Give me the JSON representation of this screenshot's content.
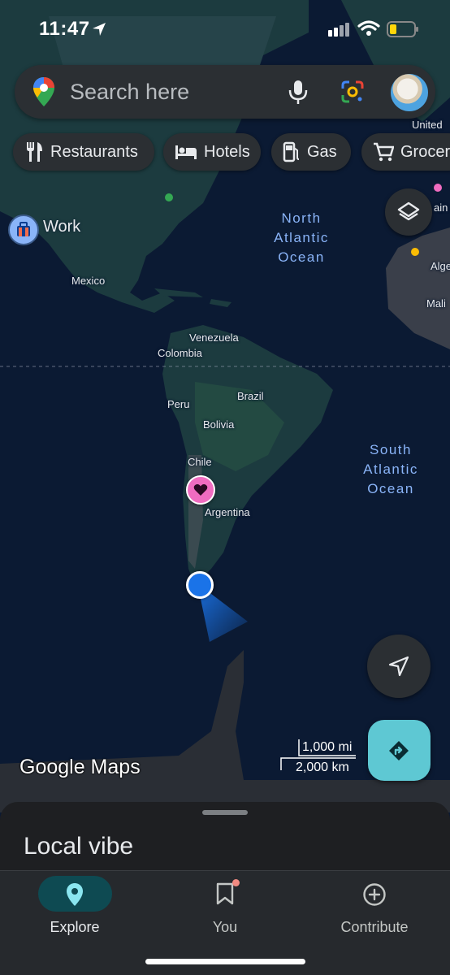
{
  "status_bar": {
    "time": "11:47"
  },
  "search": {
    "placeholder": "Search here"
  },
  "chips": [
    {
      "label": "Restaurants",
      "icon": "fork-knife-icon"
    },
    {
      "label": "Hotels",
      "icon": "bed-icon"
    },
    {
      "label": "Gas",
      "icon": "gas-pump-icon"
    },
    {
      "label": "Grocer",
      "icon": "cart-icon"
    }
  ],
  "map": {
    "saved_place": "Work",
    "countries": {
      "mexico": "Mexico",
      "venezuela": "Venezuela",
      "colombia": "Colombia",
      "peru": "Peru",
      "brazil": "Brazil",
      "bolivia": "Bolivia",
      "chile": "Chile",
      "argentina": "Argentina",
      "united": "United",
      "ain": "ain",
      "alge": "Alge",
      "mali": "Mali"
    },
    "oceans": {
      "north_atlantic": [
        "North",
        "Atlantic",
        "Ocean"
      ],
      "south_atlantic": [
        "South",
        "Atlantic",
        "Ocean"
      ]
    },
    "scale": {
      "miles": "1,000 mi",
      "km": "2,000 km"
    },
    "logo": "Google Maps"
  },
  "sheet": {
    "title": "Local vibe"
  },
  "nav": [
    {
      "label": "Explore",
      "icon": "location-pin-icon",
      "active": true
    },
    {
      "label": "You",
      "icon": "bookmark-icon",
      "active": false
    },
    {
      "label": "Contribute",
      "icon": "add-circle-icon",
      "active": false
    }
  ],
  "colors": {
    "ocean": "#0b1a33",
    "land": "#1c3b3f",
    "accent": "#5ec8d3",
    "favorite": "#f06cc0",
    "location": "#1a73e8"
  }
}
